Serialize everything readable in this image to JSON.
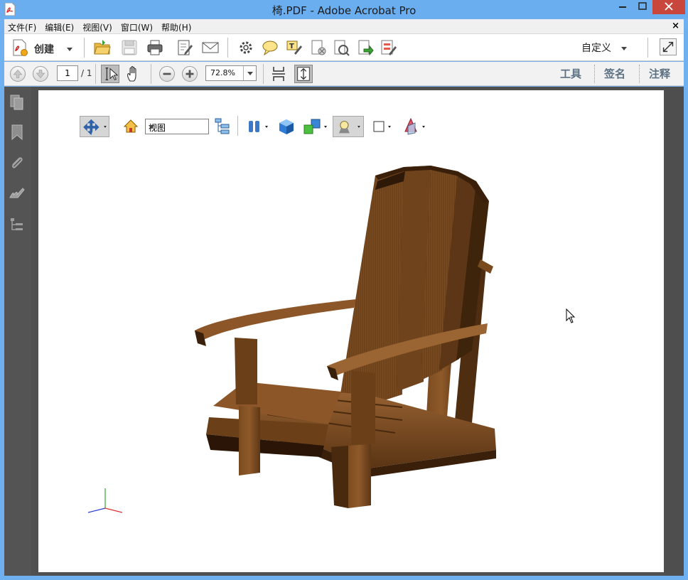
{
  "window": {
    "title": "椅.PDF - Adobe Acrobat Pro",
    "app_icon": "acrobat-pdf-icon"
  },
  "menu": {
    "items": [
      "文件(F)",
      "编辑(E)",
      "视图(V)",
      "窗口(W)",
      "帮助(H)"
    ],
    "close_glyph": "×"
  },
  "toolbar": {
    "create_label": "创建",
    "customize_label": "自定义",
    "icons": [
      "open-folder-icon",
      "save-icon",
      "print-icon",
      "edit-document-icon",
      "email-icon",
      "gear-icon",
      "comment-icon",
      "text-annotation-icon",
      "redact-icon",
      "recognize-icon",
      "export-icon",
      "form-icon"
    ]
  },
  "nav": {
    "page_current": "1",
    "page_total": "/ 1",
    "zoom": "72.8%",
    "right_tabs": [
      "工具",
      "签名",
      "注释"
    ]
  },
  "sidebar": {
    "icons": [
      "pages-icon",
      "bookmark-icon",
      "attachment-icon",
      "signature-icon",
      "layers-icon"
    ]
  },
  "toolbar3d": {
    "view_select": "视图",
    "icons": [
      "rotate-tool-icon",
      "home-view-icon",
      "model-tree-icon",
      "play-animation-icon",
      "projection-icon",
      "render-mode-icon",
      "lighting-icon",
      "background-color-icon",
      "cross-section-icon"
    ]
  },
  "colors": {
    "titlebar": "#6aaeef",
    "close_button": "#c9463d",
    "navpane": "#545454",
    "doc_bg": "#505050",
    "tab_text": "#5c7183",
    "wood_light": "#8b5a2b",
    "wood_dark": "#3a220e"
  }
}
